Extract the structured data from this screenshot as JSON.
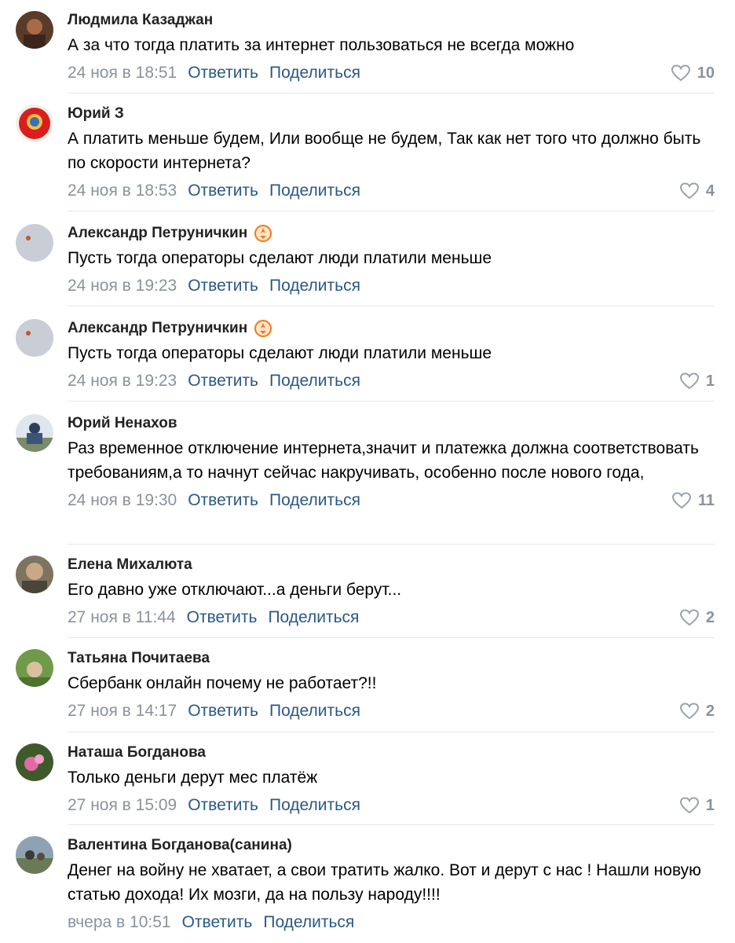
{
  "actions": {
    "reply": "Ответить",
    "share": "Поделиться"
  },
  "colors": {
    "link": "#2a5885",
    "meta": "#8a929c",
    "divider": "#e4e6ea",
    "badge": "#f07a1a"
  },
  "comments": [
    {
      "author": "Людмила Казаджан",
      "text": "А за что тогда платить за интернет пользоваться не всегда можно",
      "date": "24 ноя в 18:51",
      "likes": "10"
    },
    {
      "author": "Юрий З",
      "text": "А платить меньше будем, Или вообще не будем, Так как нет того что должно быть по скорости интернета?",
      "date": "24 ноя в 18:53",
      "likes": "4"
    },
    {
      "author": "Александр Петруничкин",
      "text": "Пусть тогда операторы сделают люди платили меньше",
      "date": "24 ноя в 19:23",
      "likes": ""
    },
    {
      "author": "Александр Петруничкин",
      "text": "Пусть тогда операторы сделают люди платили меньше",
      "date": "24 ноя в 19:23",
      "likes": "1"
    },
    {
      "author": "Юрий Ненахов",
      "text": "Раз временное отключение интернета,значит и платежка должна соответствовать требованиям,а то начнут сейчас накручивать, особенно после нового года,",
      "date": "24 ноя в 19:30",
      "likes": "11"
    },
    {
      "author": "Елена Михалюта",
      "text": "Его давно уже отключают...а деньги берут...",
      "date": "27 ноя в 11:44",
      "likes": "2"
    },
    {
      "author": "Татьяна Почитаева",
      "text": "Сбербанк онлайн почему не работает?!!",
      "date": "27 ноя в 14:17",
      "likes": "2"
    },
    {
      "author": "Наташа Богданова",
      "text": "Только деньги дерут мес платёж",
      "date": "27 ноя в 15:09",
      "likes": "1"
    },
    {
      "author": "Валентина Богданова(санина)",
      "text": "Денег на войну не хватает, а свои тратить жалко. Вот и дерут с нас ! Нашли новую статью дохода! Их мозги, да на пользу народу!!!!",
      "date": "вчера в 10:51",
      "likes": ""
    }
  ]
}
